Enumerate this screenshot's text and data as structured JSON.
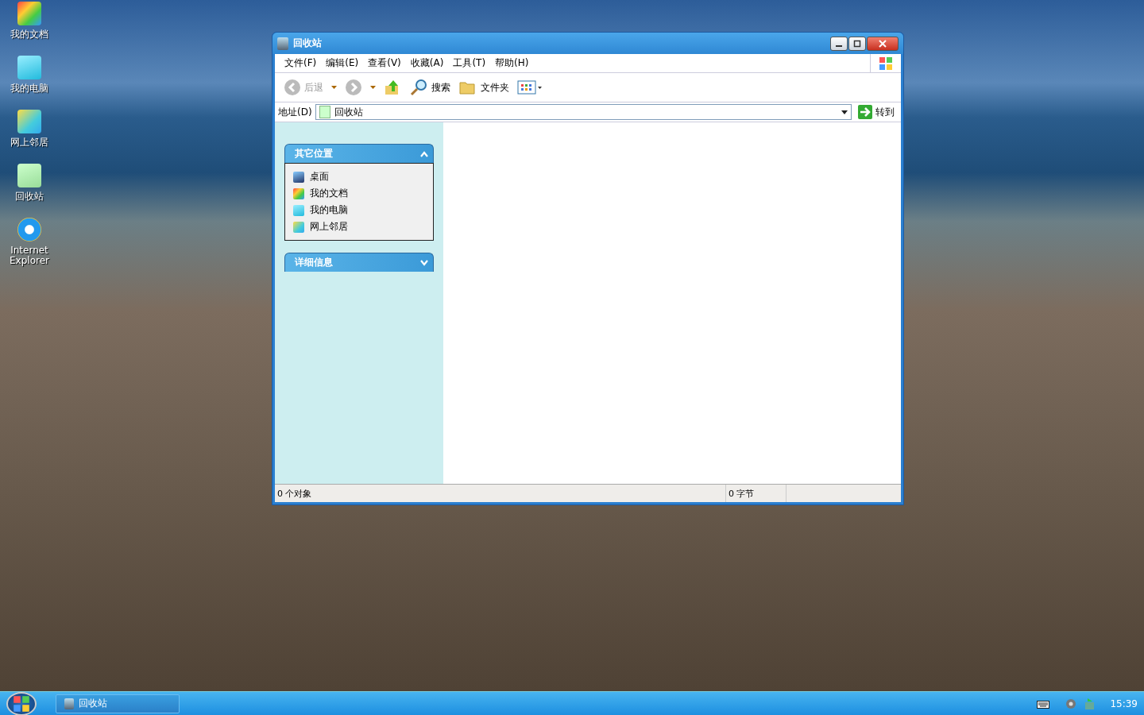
{
  "desktop_icons": [
    {
      "label": "我的文档",
      "kind": "documents"
    },
    {
      "label": "我的电脑",
      "kind": "computer"
    },
    {
      "label": "网上邻居",
      "kind": "network"
    },
    {
      "label": "回收站",
      "kind": "recycle"
    },
    {
      "label": "Internet Explorer",
      "kind": "ie"
    }
  ],
  "window": {
    "title": "回收站",
    "menu": [
      "文件(F)",
      "编辑(E)",
      "查看(V)",
      "收藏(A)",
      "工具(T)",
      "帮助(H)"
    ],
    "toolbar": {
      "back": {
        "label": "后退",
        "disabled": true
      },
      "search": "搜索",
      "folders": "文件夹"
    },
    "address": {
      "label": "地址(D)",
      "value": "回收站",
      "go": "转到"
    },
    "task_panels": [
      {
        "title": "其它位置",
        "expanded": true,
        "items": [
          {
            "label": "桌面",
            "kind": "desktop"
          },
          {
            "label": "我的文档",
            "kind": "documents"
          },
          {
            "label": "我的电脑",
            "kind": "computer"
          },
          {
            "label": "网上邻居",
            "kind": "network"
          }
        ]
      },
      {
        "title": "详细信息",
        "expanded": false
      }
    ],
    "status_bar": [
      "0 个对象",
      "0 字节"
    ]
  },
  "taskbar": {
    "tasks": [
      {
        "label": "回收站",
        "selected": false
      }
    ],
    "clock": "15:39"
  }
}
